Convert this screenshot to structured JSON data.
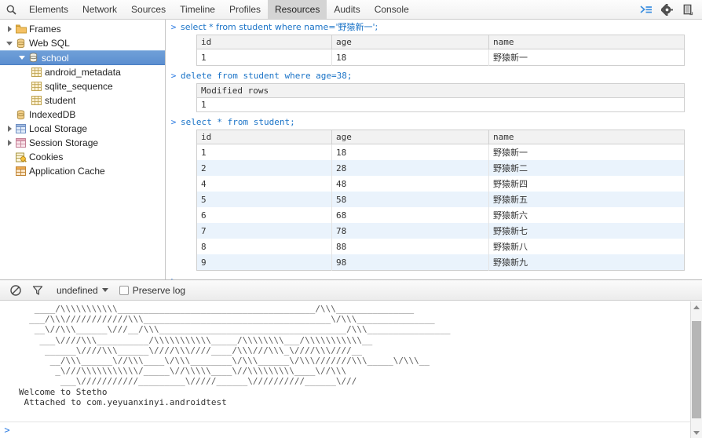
{
  "toolbar": {
    "search_icon": "search-icon",
    "tabs": [
      {
        "label": "Elements",
        "active": false
      },
      {
        "label": "Network",
        "active": false
      },
      {
        "label": "Sources",
        "active": false
      },
      {
        "label": "Timeline",
        "active": false
      },
      {
        "label": "Profiles",
        "active": false
      },
      {
        "label": "Resources",
        "active": true
      },
      {
        "label": "Audits",
        "active": false
      },
      {
        "label": "Console",
        "active": false
      }
    ],
    "right_icons": [
      "console-drawer-icon",
      "settings-gear-icon",
      "dock-side-icon"
    ],
    "accent_color": "#2a7ae2"
  },
  "sidebar": {
    "items": [
      {
        "label": "Frames",
        "icon": "folder-icon",
        "expander": "right",
        "depth": 0,
        "selected": false
      },
      {
        "label": "Web SQL",
        "icon": "database-icon",
        "expander": "down",
        "depth": 0,
        "selected": false
      },
      {
        "label": "school",
        "icon": "database-icon",
        "expander": "down",
        "depth": 1,
        "selected": true
      },
      {
        "label": "android_metadata",
        "icon": "table-icon",
        "expander": "none",
        "depth": 2,
        "selected": false
      },
      {
        "label": "sqlite_sequence",
        "icon": "table-icon",
        "expander": "none",
        "depth": 2,
        "selected": false
      },
      {
        "label": "student",
        "icon": "table-icon",
        "expander": "none",
        "depth": 2,
        "selected": false
      },
      {
        "label": "IndexedDB",
        "icon": "database-icon",
        "expander": "none",
        "depth": 0,
        "selected": false
      },
      {
        "label": "Local Storage",
        "icon": "storage-table-blue-icon",
        "expander": "right",
        "depth": 0,
        "selected": false
      },
      {
        "label": "Session Storage",
        "icon": "storage-table-pink-icon",
        "expander": "right",
        "depth": 0,
        "selected": false
      },
      {
        "label": "Cookies",
        "icon": "cookies-icon",
        "expander": "none",
        "depth": 0,
        "selected": false
      },
      {
        "label": "Application Cache",
        "icon": "appcache-table-icon",
        "expander": "none",
        "depth": 0,
        "selected": false
      }
    ],
    "selected_bg": "#5c8fd0"
  },
  "query_panel": {
    "prompt_symbol": ">",
    "blocks": [
      {
        "sql": "select * from student where name='野猿新一';",
        "columns": [
          "id",
          "age",
          "name"
        ],
        "rows": [
          [
            "1",
            "18",
            "野猿新一"
          ]
        ]
      },
      {
        "sql": "delete from student where age=38;",
        "columns": [
          "Modified rows"
        ],
        "rows": [
          [
            "1"
          ]
        ]
      },
      {
        "sql": "select * from student;",
        "columns": [
          "id",
          "age",
          "name"
        ],
        "rows": [
          [
            "1",
            "18",
            "野猿新一"
          ],
          [
            "2",
            "28",
            "野猿新二"
          ],
          [
            "4",
            "48",
            "野猿新四"
          ],
          [
            "5",
            "58",
            "野猿新五"
          ],
          [
            "6",
            "68",
            "野猿新六"
          ],
          [
            "7",
            "78",
            "野猿新七"
          ],
          [
            "8",
            "88",
            "野猿新八"
          ],
          [
            "9",
            "98",
            "野猿新九"
          ]
        ]
      }
    ],
    "input_value": ""
  },
  "console": {
    "clear_icon": "clear-console-icon",
    "filter_icon": "filter-funnel-icon",
    "context_value": "undefined",
    "preserve_log_label": "Preserve log",
    "preserve_log_checked": false,
    "prompt_symbol": ">",
    "input_value": "",
    "banner_ascii": "      ____/\\\\\\\\\\\\\\\\\\\\\\______________________________________/\\\\\\_______________\n     ___/\\\\\\////////////\\\\\\____________________________________\\/\\\\\\_______________\n      __\\//\\\\\\______\\///__/\\\\\\____________________________________/\\\\\\________________\n       ___\\////\\\\\\__________/\\\\\\\\\\\\\\\\\\\\\\_____/\\\\\\\\\\\\\\\\___/\\\\\\\\\\\\\\\\\\\\\\__\n        ______\\////\\\\\\______\\////\\\\\\////____/\\\\\\///\\\\\\_\\////\\\\\\////__\n         __/\\\\\\______\\//\\\\\\____\\/\\\\\\________\\/\\\\\\______\\/\\\\\\///////\\\\\\_____\\/\\\\\\__\n          _\\///\\\\\\\\\\\\\\\\\\\\\\/_____\\//\\\\\\\\\\____\\//\\\\\\\\\\\\\\\\\\____\\//\\\\\\\n           ___\\///////////_________\\/////______\\//////////______\\///",
    "welcome_lines": [
      "   Welcome to Stetho",
      "    Attached to com.yeyuanxinyi.androidtest"
    ],
    "scrollbar": {
      "up_icon": "scroll-up-arrow-icon",
      "down_icon": "scroll-down-arrow-icon"
    }
  }
}
